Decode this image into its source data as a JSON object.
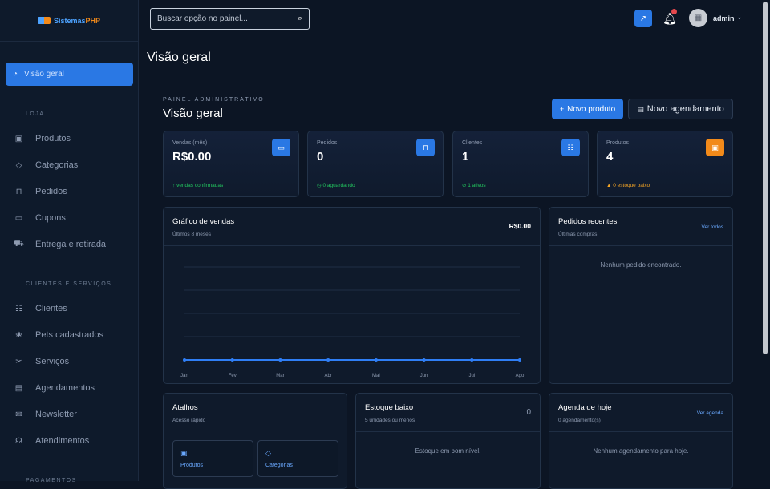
{
  "brand": {
    "part1": "Sistemas",
    "part2": "PHP"
  },
  "sidebar": {
    "active": {
      "label": "Visão geral"
    },
    "sections": [
      {
        "title": "LOJA",
        "items": [
          {
            "label": "Produtos",
            "icon": "box-icon"
          },
          {
            "label": "Categorias",
            "icon": "tag-icon"
          },
          {
            "label": "Pedidos",
            "icon": "bag-icon"
          },
          {
            "label": "Cupons",
            "icon": "ticket-icon"
          },
          {
            "label": "Entrega e retirada",
            "icon": "truck-icon"
          }
        ]
      },
      {
        "title": "CLIENTES E SERVIÇOS",
        "items": [
          {
            "label": "Clientes",
            "icon": "users-icon"
          },
          {
            "label": "Pets cadastrados",
            "icon": "paw-icon"
          },
          {
            "label": "Serviços",
            "icon": "scissors-icon"
          },
          {
            "label": "Agendamentos",
            "icon": "calendar-icon"
          },
          {
            "label": "Newsletter",
            "icon": "mail-icon"
          },
          {
            "label": "Atendimentos",
            "icon": "headset-icon"
          }
        ]
      },
      {
        "title": "PAGAMENTOS"
      }
    ]
  },
  "topbar": {
    "search_placeholder": "Buscar opção no painel...",
    "user": "admin",
    "notification_color": "#e5484d"
  },
  "page": {
    "title": "Visão geral",
    "kicker": "PAINEL ADMINISTRATIVO",
    "heading": "Visão geral"
  },
  "actions": {
    "new_product": "Novo produto",
    "new_schedule": "Novo agendamento"
  },
  "stats": [
    {
      "label": "Vendas (mês)",
      "value": "R$0.00",
      "sub": "vendas confirmadas",
      "sub_icon": "↑",
      "sub_color": "#22c55e",
      "icon_color": "#2a78e4"
    },
    {
      "label": "Pedidos",
      "value": "0",
      "sub": "0 aguardando",
      "sub_icon": "◷",
      "sub_color": "#22c55e",
      "icon_color": "#2a78e4"
    },
    {
      "label": "Clientes",
      "value": "1",
      "sub": "1 ativos",
      "sub_icon": "⊘",
      "sub_color": "#22c55e",
      "icon_color": "#2a78e4"
    },
    {
      "label": "Produtos",
      "value": "4",
      "sub": "0 estoque baixo",
      "sub_icon": "▲",
      "sub_color": "#f5a524",
      "icon_color": "#f28a1a"
    }
  ],
  "sales_chart": {
    "title": "Gráfico de vendas",
    "subtitle": "Últimos 8 meses",
    "total": "R$0.00"
  },
  "chart_data": {
    "type": "line",
    "categories": [
      "Jan",
      "Fev",
      "Mar",
      "Abr",
      "Mai",
      "Jun",
      "Jul",
      "Ago"
    ],
    "series": [
      {
        "values": [
          0,
          0,
          0,
          0,
          0,
          0,
          0,
          0
        ]
      }
    ],
    "grid": true,
    "color": "#2f7ef5"
  },
  "recent_orders": {
    "title": "Pedidos recentes",
    "subtitle": "Últimas compras",
    "link": "Ver todos",
    "empty": "Nenhum pedido encontrado."
  },
  "shortcuts": {
    "title": "Atalhos",
    "subtitle": "Acesso rápido",
    "items": [
      "Produtos",
      "Categorias"
    ]
  },
  "low_stock": {
    "title": "Estoque baixo",
    "subtitle": "5 unidades ou menos",
    "count": "0",
    "empty": "Estoque em bom nível."
  },
  "today": {
    "title": "Agenda de hoje",
    "subtitle": "0 agendamento(s)",
    "link": "Ver agenda",
    "empty": "Nenhum agendamento para hoje."
  }
}
